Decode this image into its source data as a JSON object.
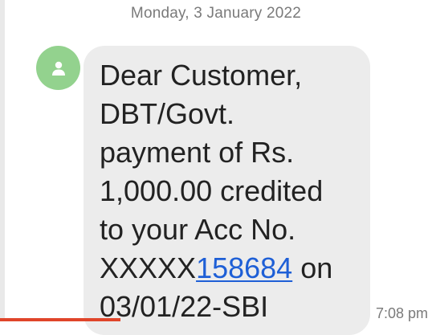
{
  "conversation": {
    "date_header": "Monday, 3 January 2022",
    "messages": [
      {
        "sender_avatar_icon": "person-icon",
        "avatar_color": "#93d28e",
        "lines": {
          "l1": "Dear Customer,",
          "l2": "DBT/Govt.",
          "l3": "payment of Rs.",
          "l4": "1,000.00 credited",
          "l5": "to your Acc No.",
          "l6_prefix": "XXXXX",
          "l6_link": "158684",
          "l6_suffix": " on",
          "l7": "03/01/22-SBI"
        },
        "timestamp": "7:08 pm",
        "bubble_color": "#ececec",
        "link_color": "#1e5fd6"
      }
    ]
  }
}
